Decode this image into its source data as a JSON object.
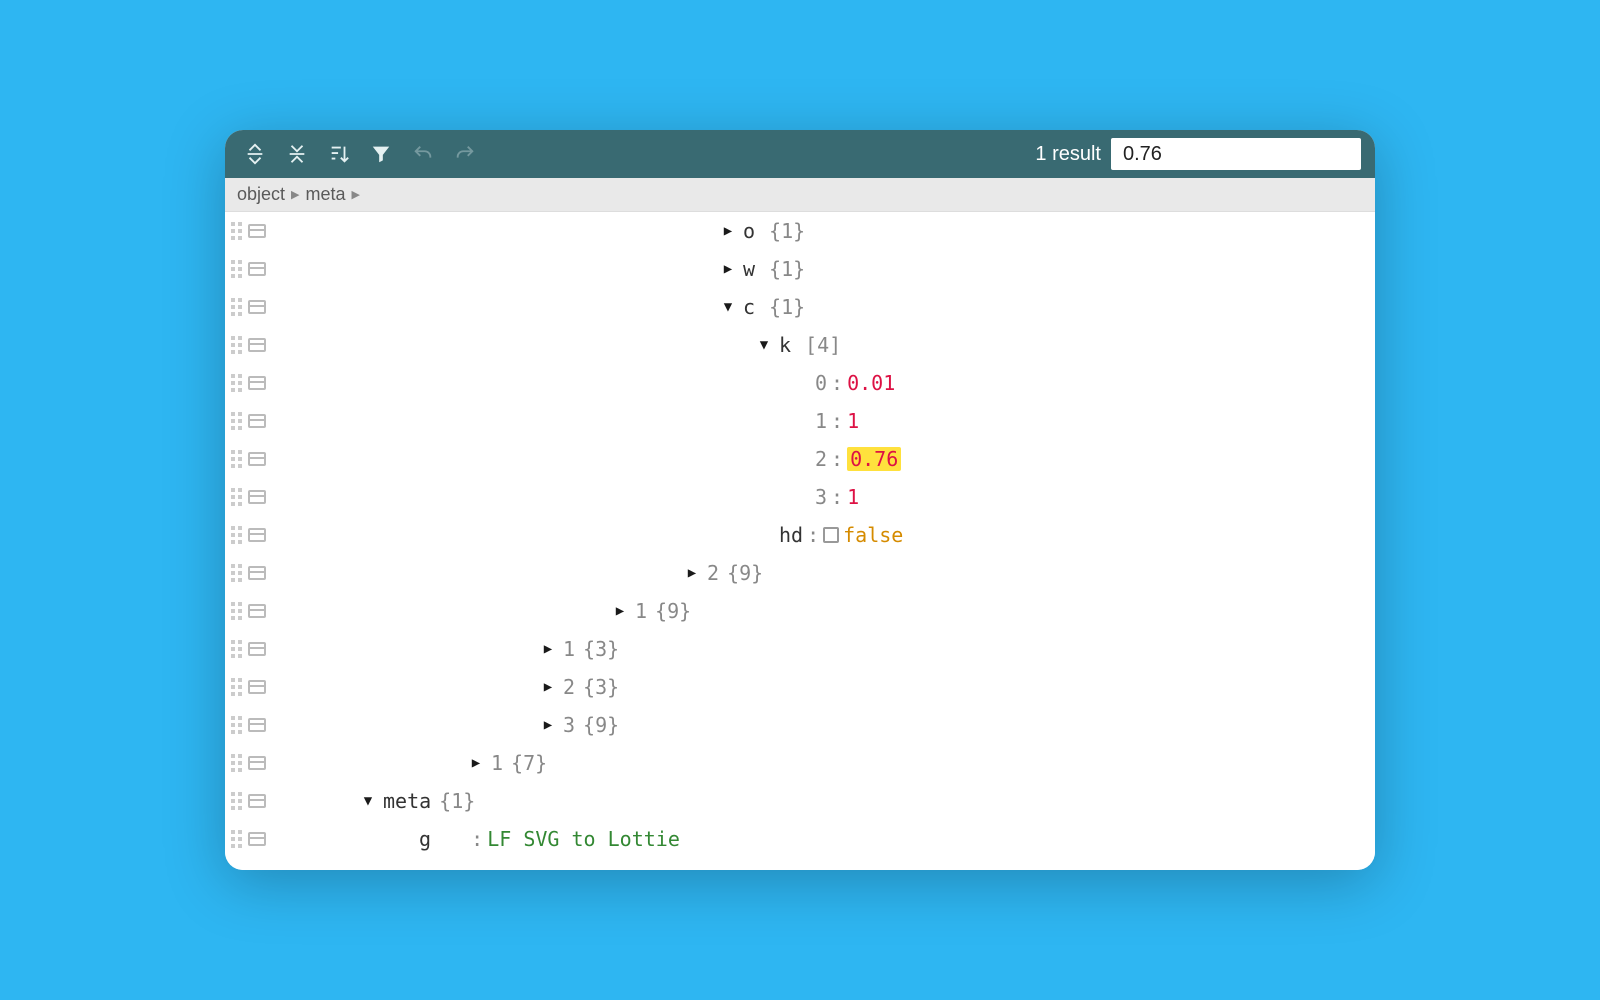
{
  "toolbar": {
    "results_label": "1 result",
    "search_value": "0.76"
  },
  "breadcrumb": [
    "object",
    "meta"
  ],
  "indent_unit": 36,
  "colors": {
    "accent": "#396a72",
    "background": "#2eb6f2",
    "highlight": "#ffe13d",
    "number": "#d14",
    "string": "#338833",
    "boolean": "#d58b00"
  },
  "rows": [
    {
      "depth": 12,
      "toggle": "▶",
      "key": "o",
      "meta": "{1}"
    },
    {
      "depth": 12,
      "toggle": "▶",
      "key": "w",
      "meta": "{1}"
    },
    {
      "depth": 12,
      "toggle": "▼",
      "key": "c",
      "meta": "{1}"
    },
    {
      "depth": 13,
      "toggle": "▼",
      "key": "k",
      "meta": "[4]"
    },
    {
      "depth": 14,
      "key_idx": "0",
      "colon": true,
      "value": "0.01",
      "vtype": "num"
    },
    {
      "depth": 14,
      "key_idx": "1",
      "colon": true,
      "value": "1",
      "vtype": "num"
    },
    {
      "depth": 14,
      "key_idx": "2",
      "colon": true,
      "value": "0.76",
      "vtype": "num",
      "highlight": true
    },
    {
      "depth": 14,
      "key_idx": "3",
      "colon": true,
      "value": "1",
      "vtype": "num"
    },
    {
      "depth": 13,
      "key": "hd",
      "colon": true,
      "checkbox": true,
      "value": "false",
      "vtype": "bool"
    },
    {
      "depth": 11,
      "toggle": "▶",
      "key_idx": "2",
      "meta": "{9}",
      "meta_tight": true
    },
    {
      "depth": 9,
      "toggle": "▶",
      "key_idx": "1",
      "meta": "{9}",
      "meta_tight": true
    },
    {
      "depth": 7,
      "toggle": "▶",
      "key_idx": "1",
      "meta": "{3}",
      "meta_tight": true
    },
    {
      "depth": 7,
      "toggle": "▶",
      "key_idx": "2",
      "meta": "{3}",
      "meta_tight": true
    },
    {
      "depth": 7,
      "toggle": "▶",
      "key_idx": "3",
      "meta": "{9}",
      "meta_tight": true
    },
    {
      "depth": 5,
      "toggle": "▶",
      "key_idx": "1",
      "meta": "{7}",
      "meta_tight": true
    },
    {
      "depth": 2,
      "toggle": "▼",
      "key": "meta",
      "meta": "{1}",
      "meta_tight": true
    },
    {
      "depth": 3,
      "key": "g",
      "colon": true,
      "key_pad": true,
      "value": "LF SVG to Lottie",
      "vtype": "str"
    }
  ]
}
